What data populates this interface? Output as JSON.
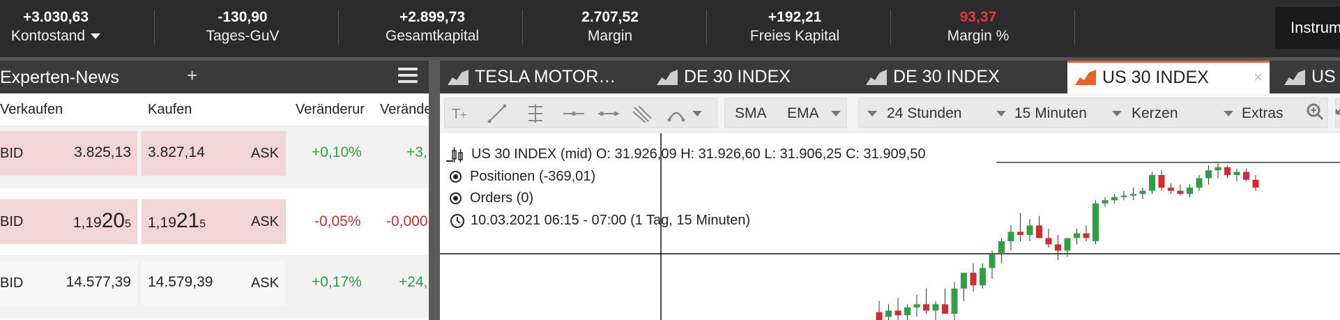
{
  "account": {
    "stats": [
      {
        "value": "+3.030,63",
        "label": "Kontostand",
        "value_color": "#ffffff"
      },
      {
        "value": "-130,90",
        "label": "Tages-GuV",
        "value_color": "#ffffff"
      },
      {
        "value": "+2.899,73",
        "label": "Gesamtkapital",
        "value_color": "#ffffff"
      },
      {
        "value": "2.707,52",
        "label": "Margin",
        "value_color": "#ffffff"
      },
      {
        "value": "+192,21",
        "label": "Freies Kapital",
        "value_color": "#ffffff"
      },
      {
        "value": "93,37",
        "label": "Margin %",
        "value_color": "#e0393e"
      }
    ],
    "instrument_button": "Instrum"
  },
  "left_panel": {
    "title": "Experten-News",
    "add_symbol": "+",
    "columns": {
      "sell": "Verkaufen",
      "buy": "Kaufen",
      "change1": "Veränderur",
      "change2": "Veränder"
    },
    "rows": [
      {
        "bid_label": "BID",
        "bid": "3.825,13",
        "ask": "3.827,14",
        "ask_label": "ASK",
        "change_pct": "+0,10%",
        "change_abs": "+3,",
        "trend": "up",
        "highlight": true
      },
      {
        "bid_label": "BID",
        "bid_main": "1,19",
        "bid_big": "20",
        "bid_sub": "5",
        "ask_main": "1,19",
        "ask_big": "21",
        "ask_sub": "5",
        "ask_label": "ASK",
        "change_pct": "-0,05%",
        "change_abs": "-0,000",
        "trend": "down",
        "highlight": true
      },
      {
        "bid_label": "BID",
        "bid": "14.577,39",
        "ask": "14.579,39",
        "ask_label": "ASK",
        "change_pct": "+0,17%",
        "change_abs": "+24,",
        "trend": "up",
        "highlight": false
      }
    ]
  },
  "chart_tabs": [
    {
      "label": "TESLA MOTOR…",
      "active": false
    },
    {
      "label": "DE 30 INDEX",
      "active": false
    },
    {
      "label": "DE 30 INDEX",
      "active": false
    },
    {
      "label": "US 30 INDEX",
      "active": true,
      "close": "×"
    },
    {
      "label": "US",
      "active": false
    }
  ],
  "toolbar": {
    "sma": "SMA",
    "ema": "EMA",
    "period": "24 Stunden",
    "interval": "15 Minuten",
    "chart_type": "Kerzen",
    "extras": "Extras"
  },
  "chart_info": {
    "ohlc": "US 30 INDEX (mid)  O: 31.926,09  H: 31.926,60  L: 31.906,25  C: 31.909,50",
    "positions": "Positionen (-369,01)",
    "orders": "Orders (0)",
    "time": "10.03.2021 06:15 - 07:00  (1 Tag, 15 Minuten)"
  },
  "colors": {
    "up": "#2ea043",
    "down": "#d62a31",
    "accent": "#e8632b"
  },
  "chart_data": {
    "type": "candlestick",
    "candles": [
      {
        "o": 0.05,
        "h": 0.12,
        "l": 0.0,
        "c": 0.0
      },
      {
        "o": 0.02,
        "h": 0.1,
        "l": 0.0,
        "c": 0.06
      },
      {
        "o": 0.06,
        "h": 0.14,
        "l": 0.0,
        "c": 0.03
      },
      {
        "o": 0.03,
        "h": 0.1,
        "l": 0.0,
        "c": 0.08
      },
      {
        "o": 0.08,
        "h": 0.16,
        "l": 0.02,
        "c": 0.1
      },
      {
        "o": 0.1,
        "h": 0.2,
        "l": 0.04,
        "c": 0.06
      },
      {
        "o": 0.06,
        "h": 0.12,
        "l": 0.0,
        "c": 0.1
      },
      {
        "o": 0.1,
        "h": 0.2,
        "l": 0.05,
        "c": 0.04
      },
      {
        "o": 0.04,
        "h": 0.24,
        "l": 0.0,
        "c": 0.2
      },
      {
        "o": 0.2,
        "h": 0.26,
        "l": 0.12,
        "c": 0.3
      },
      {
        "o": 0.3,
        "h": 0.36,
        "l": 0.18,
        "c": 0.22
      },
      {
        "o": 0.22,
        "h": 0.36,
        "l": 0.2,
        "c": 0.33
      },
      {
        "o": 0.33,
        "h": 0.44,
        "l": 0.26,
        "c": 0.42
      },
      {
        "o": 0.42,
        "h": 0.52,
        "l": 0.36,
        "c": 0.5
      },
      {
        "o": 0.5,
        "h": 0.6,
        "l": 0.44,
        "c": 0.56
      },
      {
        "o": 0.56,
        "h": 0.68,
        "l": 0.5,
        "c": 0.54
      },
      {
        "o": 0.54,
        "h": 0.64,
        "l": 0.5,
        "c": 0.6
      },
      {
        "o": 0.6,
        "h": 0.66,
        "l": 0.52,
        "c": 0.52
      },
      {
        "o": 0.52,
        "h": 0.58,
        "l": 0.46,
        "c": 0.48
      },
      {
        "o": 0.48,
        "h": 0.54,
        "l": 0.38,
        "c": 0.44
      },
      {
        "o": 0.44,
        "h": 0.5,
        "l": 0.4,
        "c": 0.52
      },
      {
        "o": 0.52,
        "h": 0.58,
        "l": 0.48,
        "c": 0.55
      },
      {
        "o": 0.55,
        "h": 0.6,
        "l": 0.5,
        "c": 0.52
      },
      {
        "o": 0.5,
        "h": 0.76,
        "l": 0.48,
        "c": 0.74
      },
      {
        "o": 0.74,
        "h": 0.78,
        "l": 0.72,
        "c": 0.76
      },
      {
        "o": 0.76,
        "h": 0.8,
        "l": 0.74,
        "c": 0.78
      },
      {
        "o": 0.78,
        "h": 0.82,
        "l": 0.76,
        "c": 0.79
      },
      {
        "o": 0.79,
        "h": 0.84,
        "l": 0.76,
        "c": 0.8
      },
      {
        "o": 0.8,
        "h": 0.84,
        "l": 0.77,
        "c": 0.82
      },
      {
        "o": 0.82,
        "h": 0.94,
        "l": 0.8,
        "c": 0.92
      },
      {
        "o": 0.92,
        "h": 0.95,
        "l": 0.82,
        "c": 0.84
      },
      {
        "o": 0.84,
        "h": 0.87,
        "l": 0.8,
        "c": 0.82
      },
      {
        "o": 0.82,
        "h": 0.86,
        "l": 0.79,
        "c": 0.8
      },
      {
        "o": 0.8,
        "h": 0.86,
        "l": 0.78,
        "c": 0.84
      },
      {
        "o": 0.84,
        "h": 0.92,
        "l": 0.82,
        "c": 0.9
      },
      {
        "o": 0.9,
        "h": 0.98,
        "l": 0.86,
        "c": 0.95
      },
      {
        "o": 0.95,
        "h": 1.0,
        "l": 0.9,
        "c": 0.97
      },
      {
        "o": 0.97,
        "h": 0.98,
        "l": 0.9,
        "c": 0.92
      },
      {
        "o": 0.92,
        "h": 0.96,
        "l": 0.88,
        "c": 0.94
      },
      {
        "o": 0.94,
        "h": 0.96,
        "l": 0.88,
        "c": 0.89
      },
      {
        "o": 0.89,
        "h": 0.92,
        "l": 0.82,
        "c": 0.84
      }
    ]
  }
}
